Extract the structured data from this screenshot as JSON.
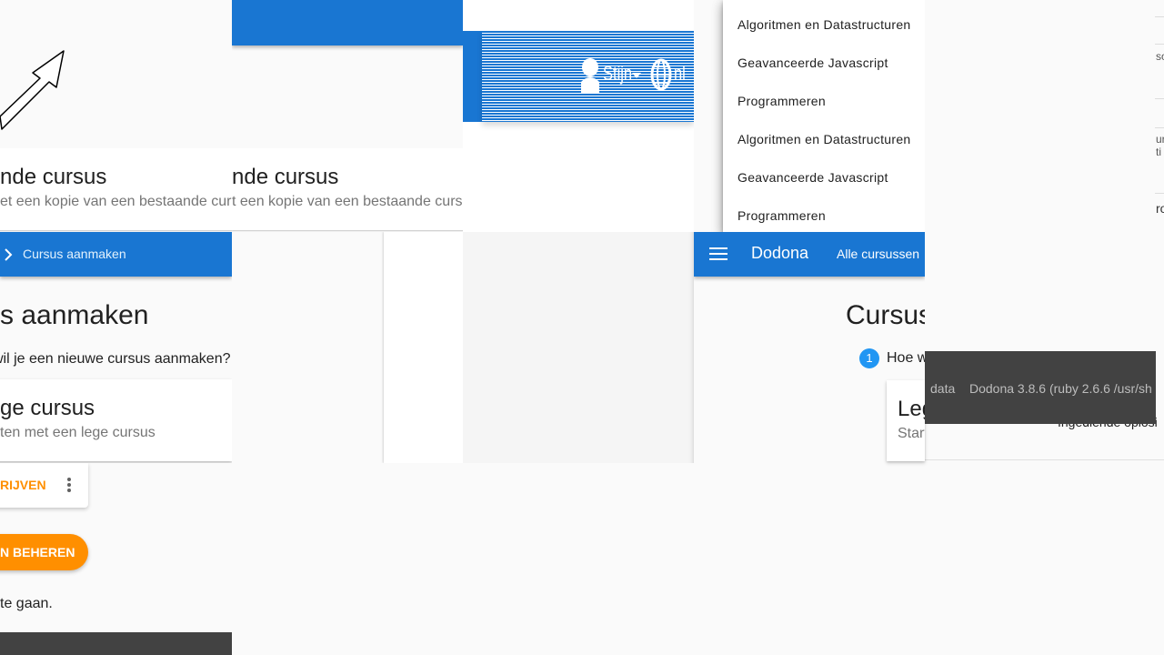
{
  "app": {
    "brand": "Dodona",
    "nav_all_courses": "Alle cursussen",
    "breadcrumb_current": "Cursus aanmaken",
    "user_name": "Stijn",
    "language": "nl"
  },
  "new_course_page": {
    "title_fragment": "s aanmaken",
    "title_fragment_right": "Cursus",
    "question_fragment": "wil je een nieuwe cursus aanmaken?",
    "question_fragment_right": "Hoe w",
    "step_number": "1",
    "option_empty": {
      "title_fragment": "ge cursus",
      "subtitle_fragment": "ten met een lege cursus",
      "title_fragment_right": "Leg",
      "subtitle_fragment_right": "Start"
    },
    "option_copy": {
      "title_left": "nde cursus",
      "subtitle_left": "et een kopie van een bestaande cursus",
      "title_right": "nde cursus",
      "subtitle_right": "t een kopie van een bestaande cursus"
    }
  },
  "course_card": {
    "register_button": "RIJVEN",
    "manage_button": "N BEHEREN",
    "go_text": "te gaan."
  },
  "course_menu": {
    "items_group_1": [
      "Algoritmen en Datastructuren",
      "Geavanceerde Javascript",
      "Programmeren"
    ],
    "items_group_2": [
      "Algoritmen en Datastructuren",
      "Geavanceerde Javascript",
      "Programmeren"
    ]
  },
  "footer": {
    "data_link": "data",
    "version": "Dodona 3.8.6 (ruby 2.6.6 /usr/sh"
  },
  "right_edge_fragments": {
    "frag1": "so",
    "frag2a": "ur",
    "frag2b": "ti",
    "frag3": "ro",
    "submitted_exercises": "Ingediende oplosi"
  },
  "colors": {
    "primary": "#1976d2",
    "accent": "#ff8f00",
    "footer_bg": "#424242",
    "step_badge": "#2196f3"
  }
}
